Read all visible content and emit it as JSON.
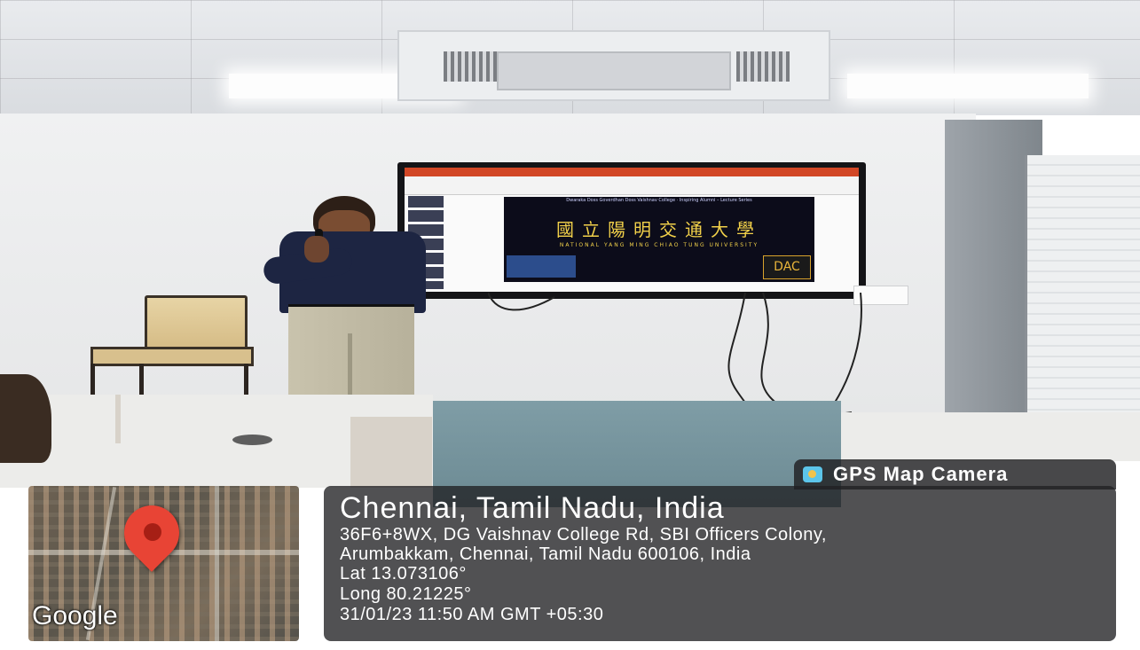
{
  "presentation": {
    "slide_header": "Dwaraka Doss Goverdhan Doss Vaishnav College · Inspiring Alumni – Lecture Series",
    "university_chinese": "國立陽明交通大學",
    "university_english": "NATIONAL YANG MING CHIAO TUNG UNIVERSITY",
    "logo_text": "DAC"
  },
  "gps_overlay": {
    "app_name": "GPS Map Camera",
    "place": "Chennai, Tamil Nadu, India",
    "address_line1": "36F6+8WX, DG Vaishnav College Rd, SBI Officers Colony,",
    "address_line2": "Arumbakkam, Chennai, Tamil Nadu 600106, India",
    "latitude": "Lat 13.073106°",
    "longitude": "Long 80.21225°",
    "datetime": "31/01/23 11:50 AM GMT +05:30",
    "map_provider": "Google",
    "icons": {
      "camera": "gps-camera-icon",
      "pin": "map-pin-icon"
    },
    "colors": {
      "pin": "#e84435",
      "overlay": "#202022"
    }
  }
}
